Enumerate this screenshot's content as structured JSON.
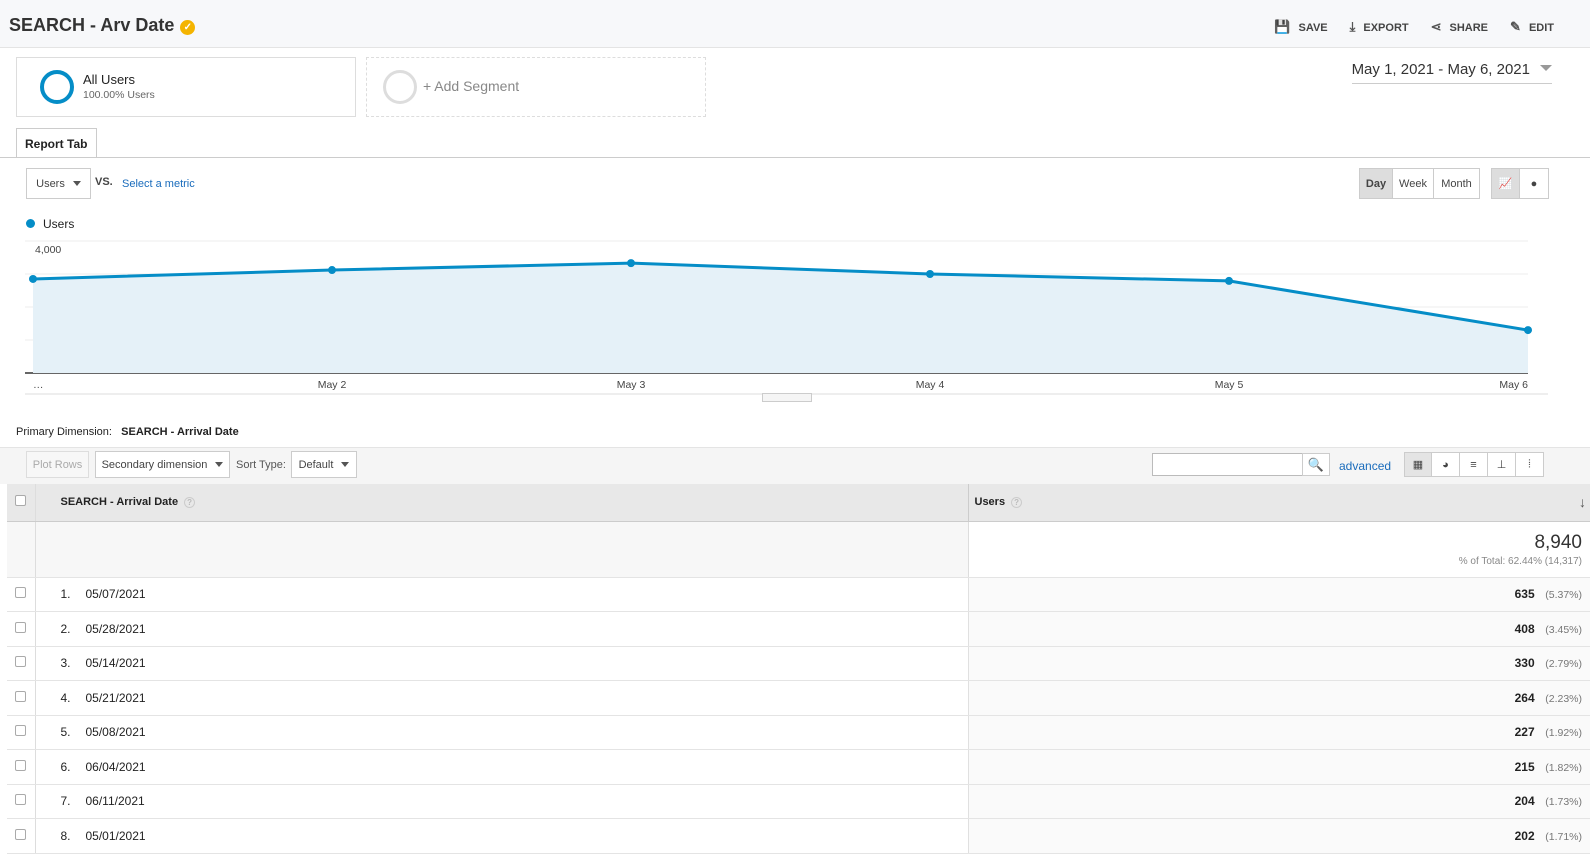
{
  "header": {
    "title": "SEARCH - Arv Date",
    "actions": [
      "SAVE",
      "EXPORT",
      "SHARE",
      "EDIT"
    ]
  },
  "segments": {
    "active": {
      "name": "All Users",
      "pct": "100.00% Users"
    },
    "add": "+ Add Segment"
  },
  "date_range": "May 1, 2021 - May 6, 2021",
  "report_tab": "Report Tab",
  "metric": {
    "selected": "Users",
    "vs": "VS.",
    "select": "Select a metric"
  },
  "granularity": [
    "Day",
    "Week",
    "Month"
  ],
  "colors": {
    "accent": "#058dc7",
    "fill": "#e5f1f8",
    "link": "#1a6cbc"
  },
  "chart_data": {
    "type": "area",
    "legend": [
      "Users"
    ],
    "x": [
      "…",
      "May 2",
      "May 3",
      "May 4",
      "May 5",
      "May 6"
    ],
    "series": [
      {
        "name": "Users",
        "values": [
          2850,
          3120,
          3330,
          3000,
          2790,
          1300
        ]
      }
    ],
    "yticks": [
      "2,000",
      "4,000"
    ],
    "ylim": [
      0,
      4000
    ],
    "grid": true
  },
  "table": {
    "primary_label": "Primary Dimension:",
    "primary_value": "SEARCH - Arrival Date",
    "plot_rows": "Plot Rows",
    "secondary": "Secondary dimension",
    "sort_label": "Sort Type:",
    "sort_value": "Default",
    "advanced": "advanced",
    "col1": "SEARCH - Arrival Date",
    "col2": "Users",
    "total": "8,940",
    "total_sub": "% of Total: 62.44% (14,317)",
    "rows": [
      {
        "n": "1.",
        "d": "05/07/2021",
        "v": "635",
        "p": "(5.37%)"
      },
      {
        "n": "2.",
        "d": "05/28/2021",
        "v": "408",
        "p": "(3.45%)"
      },
      {
        "n": "3.",
        "d": "05/14/2021",
        "v": "330",
        "p": "(2.79%)"
      },
      {
        "n": "4.",
        "d": "05/21/2021",
        "v": "264",
        "p": "(2.23%)"
      },
      {
        "n": "5.",
        "d": "05/08/2021",
        "v": "227",
        "p": "(1.92%)"
      },
      {
        "n": "6.",
        "d": "06/04/2021",
        "v": "215",
        "p": "(1.82%)"
      },
      {
        "n": "7.",
        "d": "06/11/2021",
        "v": "204",
        "p": "(1.73%)"
      },
      {
        "n": "8.",
        "d": "05/01/2021",
        "v": "202",
        "p": "(1.71%)"
      }
    ]
  }
}
